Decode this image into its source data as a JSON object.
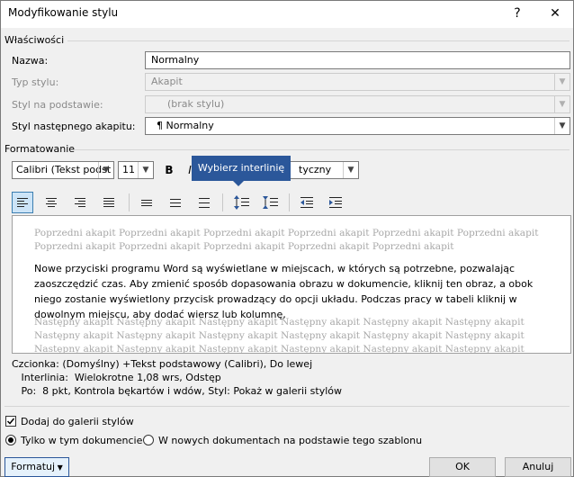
{
  "window": {
    "title": "Modyfikowanie stylu",
    "help": "?",
    "close": "✕"
  },
  "properties": {
    "heading": "Właściwości",
    "name_label": "Nazwa:",
    "name_value": "Normalny",
    "type_label": "Typ stylu:",
    "type_value": "Akapit",
    "based_label": "Styl na podstawie:",
    "based_value": "(brak stylu)",
    "next_label": "Styl następnego akapitu:",
    "next_value": "¶  Normalny"
  },
  "formatting": {
    "heading": "Formatowanie",
    "font": "Calibri (Tekst podst",
    "size": "11",
    "bold": "B",
    "italic_partial": "I",
    "color": "Automatyczny",
    "color_visible": "tyczny"
  },
  "tooltip": "Wybierz interlinię",
  "preview": {
    "prev_lines": [
      "Poprzedni akapit Poprzedni akapit Poprzedni akapit Poprzedni akapit Poprzedni akapit Poprzedni akapit",
      "Poprzedni akapit Poprzedni akapit Poprzedni akapit Poprzedni akapit Poprzedni akapit"
    ],
    "main_lines": [
      "Nowe przyciski programu Word są wyświetlane w miejscach, w których są potrzebne, pozwalając",
      "zaoszczędzić czas. Aby zmienić sposób dopasowania obrazu w dokumencie, kliknij ten obraz, a obok",
      "niego zostanie wyświetlony przycisk prowadzący do opcji układu. Podczas pracy w tabeli kliknij w",
      "dowolnym miejscu, aby dodać wiersz lub kolumnę,"
    ],
    "next_lines": [
      "Następny akapit Następny akapit Następny akapit Następny akapit Następny akapit Następny akapit",
      "Następny akapit Następny akapit Następny akapit Następny akapit Następny akapit Następny akapit",
      "Następny akapit Następny akapit Następny akapit Następny akapit Następny akapit Następny akapit"
    ]
  },
  "description": [
    "Czcionka: (Domyślny) +Tekst podstawowy (Calibri), Do lewej",
    "   Interlinia:  Wielokrotne 1,08 wrs, Odstęp",
    "   Po:  8 pkt, Kontrola bękartów i wdów, Styl: Pokaż w galerii stylów"
  ],
  "options": {
    "add_gallery": "Dodaj do galerii stylów",
    "add_gallery_checked": true,
    "only_doc": "Tylko w tym dokumencie",
    "new_docs": "W nowych dokumentach na podstawie tego szablonu",
    "selected": "only_doc"
  },
  "buttons": {
    "format": "Formatuj",
    "ok": "OK",
    "cancel": "Anuluj"
  },
  "colors": {
    "accent": "#2b579a",
    "tooltip_bg": "#2b579a",
    "active_tool": "#cce4f7"
  }
}
